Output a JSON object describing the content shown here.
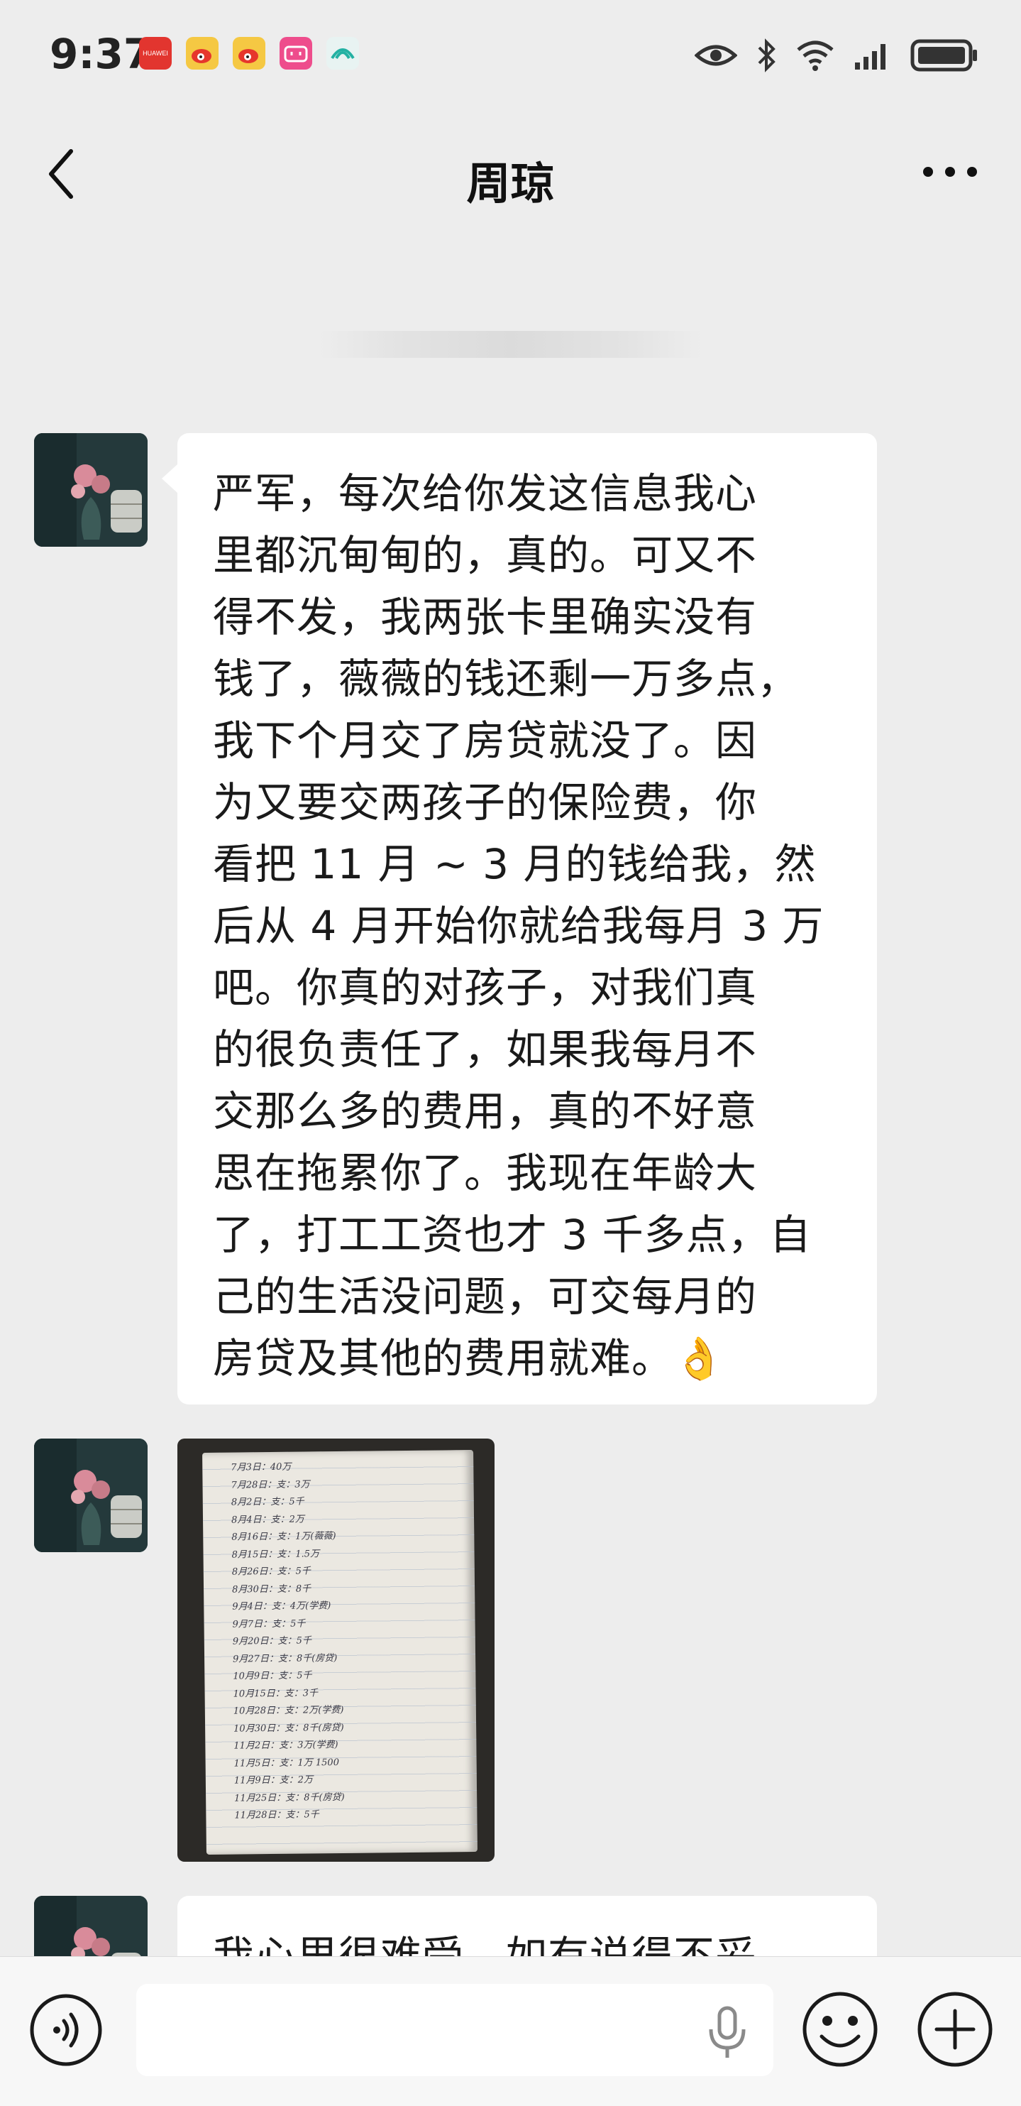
{
  "status_bar": {
    "time": "9:37",
    "notification_icons": [
      "huawei-app-icon",
      "weibo-icon",
      "weibo-icon",
      "bilibili-icon",
      "ai-app-icon"
    ],
    "right_icons": [
      "eye-icon",
      "bluetooth-icon",
      "wifi-icon",
      "signal-icon",
      "battery-icon"
    ]
  },
  "header": {
    "title": "周琼"
  },
  "messages": [
    {
      "type": "text",
      "lines": [
        "严军，每次给你发这信息我心",
        "里都沉甸甸的，真的。可又不",
        "得不发，我两张卡里确实没有",
        "钱了，薇薇的钱还剩一万多点，",
        "我下个月交了房贷就没了。因",
        "为又要交两孩子的保险费，你",
        "看把 11 月 ~ 3 月的钱给我，然",
        "后从 4 月开始你就给我每月 3 万",
        "吧。你真的对孩子，对我们真",
        "的很负责任了，如果我每月不",
        "交那么多的费用，真的不好意",
        "思在拖累你了。我现在年龄大",
        "了，打工工资也才 3 千多点，自",
        "己的生活没问题，可交每月的",
        "房贷及其他的费用就难。👌"
      ]
    },
    {
      "type": "image",
      "notebook_lines": [
        "7月3日：40万",
        "7月28日：支：3万",
        "8月2日：支：5千",
        "8月4日：支：2万",
        "8月16日：支：1万(薇薇)",
        "8月15日：支：1.5万",
        "8月26日：支：5千",
        "8月30日：支：8千",
        "9月4日：支：4万(学费)",
        "9月7日：支：5千",
        "9月20日：支：5千",
        "9月27日：支：8千(房贷)",
        "10月9日：支：5千",
        "10月15日：支：3千",
        "10月28日：支：2万(学费)",
        "10月30日：支：8千(房贷)",
        "11月2日：支：3万(学费)",
        "11月5日：支：1万 1500",
        "11月9日：支：2万",
        "11月25日：支：8千(房贷)",
        "11月28日：支：5千"
      ]
    },
    {
      "type": "text",
      "lines": [
        "我心里很难受，如有说得不妥"
      ]
    }
  ],
  "input_bar": {
    "voice_icon": "voice-mode-icon",
    "mic_icon": "microphone-icon",
    "emoji_icon": "emoji-icon",
    "plus_icon": "plus-icon"
  }
}
